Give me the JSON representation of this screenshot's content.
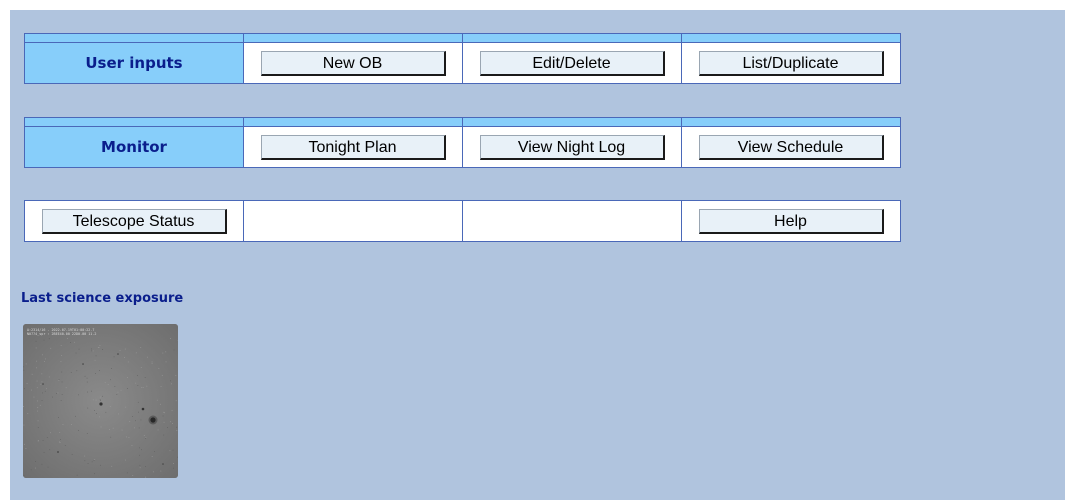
{
  "rows": {
    "user_inputs": {
      "label": "User inputs",
      "buttons": [
        "New OB",
        "Edit/Delete",
        "List/Duplicate"
      ]
    },
    "monitor": {
      "label": "Monitor",
      "buttons": [
        "Tonight Plan",
        "View Night Log",
        "View Schedule"
      ]
    },
    "utility": {
      "telescope_status": "Telescope Status",
      "help": "Help"
    }
  },
  "last_exposure": {
    "title": "Last science exposure",
    "thumbnail_caption_line1": "A:2314/16 - 2022-07-19T01:00:22.7",
    "thumbnail_caption_line2": "N0774_spr : 2BEE40.00 22D0.00 11.2"
  },
  "colors": {
    "page_background": "#b0c4de",
    "label_cell": "#87cefa",
    "label_text": "#0a1e8c",
    "cell_border": "#4a68b8",
    "button_face": "#e8f1f8"
  }
}
